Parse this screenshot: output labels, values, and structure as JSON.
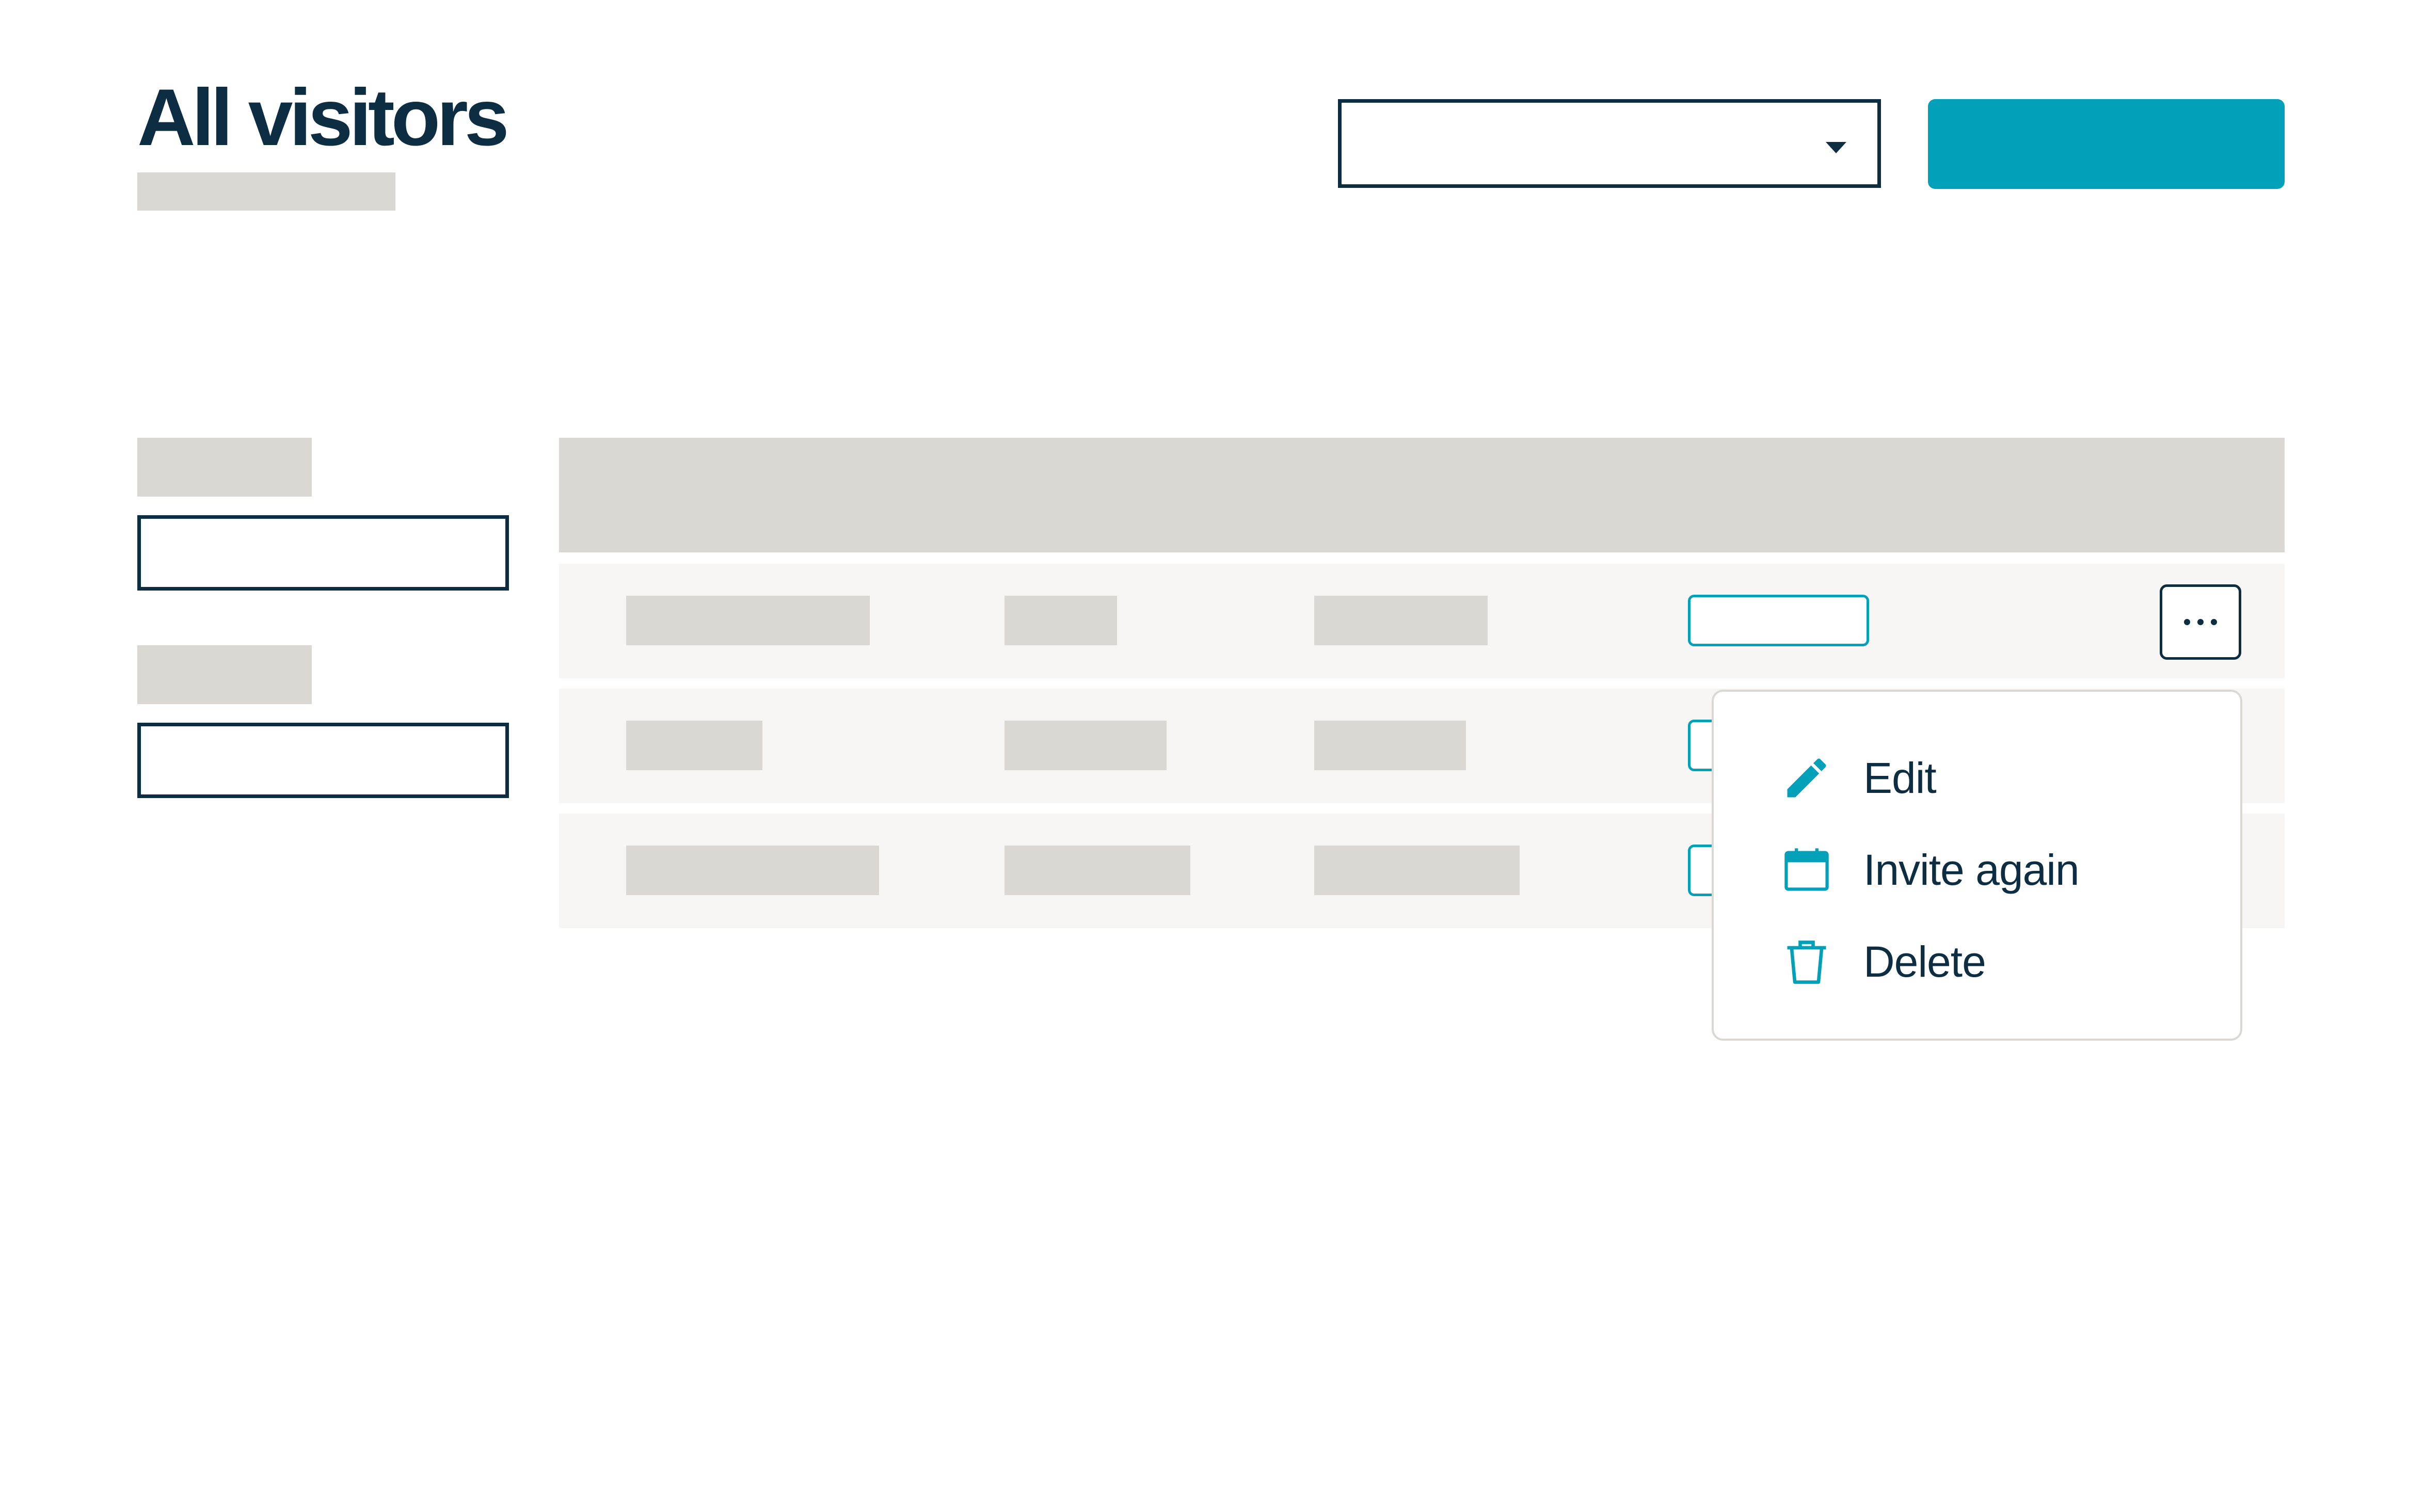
{
  "header": {
    "title": "All visitors",
    "filter_select": {
      "value": ""
    },
    "primary_button": {
      "label": ""
    }
  },
  "colors": {
    "accent": "#03a0b9",
    "text": "#0d2d42",
    "placeholder": "#dbd7d3",
    "row_background": "#f7f6f4"
  },
  "sidebar_filters": [
    {
      "label": "",
      "value": ""
    },
    {
      "label": "",
      "value": ""
    }
  ],
  "table": {
    "columns": [
      "",
      "",
      "",
      "",
      ""
    ],
    "rows": [
      {
        "cells": [
          "",
          "",
          ""
        ],
        "status": ""
      },
      {
        "cells": [
          "",
          "",
          ""
        ],
        "status": ""
      },
      {
        "cells": [
          "",
          "",
          ""
        ],
        "status": ""
      }
    ]
  },
  "row_menu": {
    "trigger_icon": "more-horizontal-icon",
    "items": [
      {
        "label": "Edit",
        "icon": "pencil-icon"
      },
      {
        "label": "Invite again",
        "icon": "calendar-icon"
      },
      {
        "label": "Delete",
        "icon": "trash-icon"
      }
    ]
  }
}
